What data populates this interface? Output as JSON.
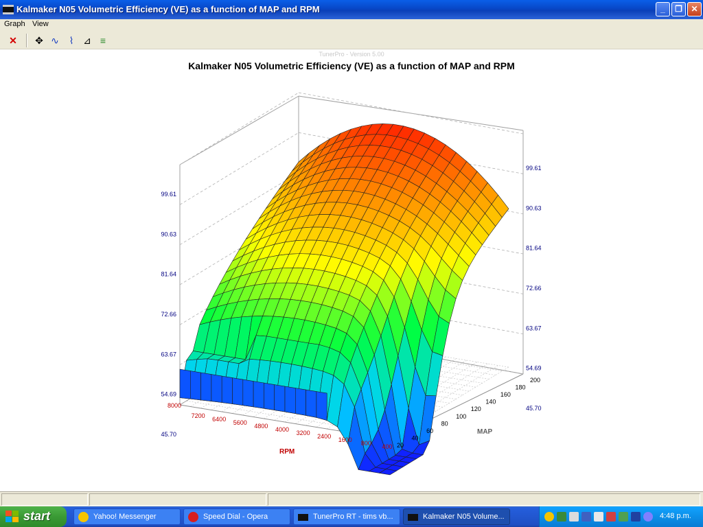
{
  "window": {
    "title": "Kalmaker N05 Volumetric Efficiency (VE) as a function of MAP and RPM",
    "min_label": "_",
    "max_label": "❐",
    "close_label": "✕"
  },
  "menu": {
    "items": [
      "Graph",
      "View"
    ]
  },
  "toolbar": {
    "tools": [
      {
        "name": "close-x-icon",
        "glyph": "✕",
        "color": "#d40000"
      },
      {
        "name": "move-icon",
        "glyph": "✥",
        "color": "#000000"
      },
      {
        "name": "line-plot-icon",
        "glyph": "∿",
        "color": "#1a3fc0"
      },
      {
        "name": "chart-icon",
        "glyph": "⌇",
        "color": "#1a3fc0"
      },
      {
        "name": "surface-icon",
        "glyph": "⊿",
        "color": "#000000"
      },
      {
        "name": "legend-icon",
        "glyph": "≡",
        "color": "#2a8a2a"
      }
    ]
  },
  "graph": {
    "watermark": "TunerPro - Version 5.00",
    "title": "Kalmaker N05 Volumetric Efficiency (VE) as a function of MAP and RPM",
    "colors": {
      "axis_text": "#000080",
      "rpm_text": "#c00000"
    }
  },
  "chart_data": {
    "type": "surface",
    "title": "Kalmaker N05 Volumetric Efficiency (VE) as a function of MAP and RPM",
    "xlabel": "RPM",
    "ylabel": "MAP",
    "zlabel": "",
    "x_ticks": [
      "400",
      "800",
      "1600",
      "2400",
      "3200",
      "4000",
      "4800",
      "5600",
      "6400",
      "7200",
      "8000"
    ],
    "y_ticks": [
      "20",
      "40",
      "60",
      "80",
      "100",
      "120",
      "140",
      "160",
      "180",
      "200"
    ],
    "z_ticks_left": [
      "45.70",
      "54.69",
      "63.67",
      "72.66",
      "81.64",
      "90.63",
      "99.61"
    ],
    "z_ticks_right": [
      "45.70",
      "54.69",
      "63.67",
      "72.66",
      "81.64",
      "90.63",
      "99.61"
    ],
    "z_range": [
      45.7,
      99.61
    ],
    "color_scale": [
      "#1020ff",
      "#00d0ff",
      "#00ff40",
      "#ffff00",
      "#ff8000",
      "#ff0000"
    ],
    "grid": true
  },
  "taskbar": {
    "start_label": "start",
    "tasks": [
      {
        "label": "Yahoo! Messenger",
        "icon_color": "#f5c400"
      },
      {
        "label": "Speed Dial - Opera",
        "icon_color": "#d81e1e"
      },
      {
        "label": "TunerPro RT - tims vb...",
        "icon_color": "#111111"
      },
      {
        "label": "Kalmaker N05 Volume...",
        "icon_color": "#111111"
      }
    ],
    "clock": "4:48 p.m."
  }
}
